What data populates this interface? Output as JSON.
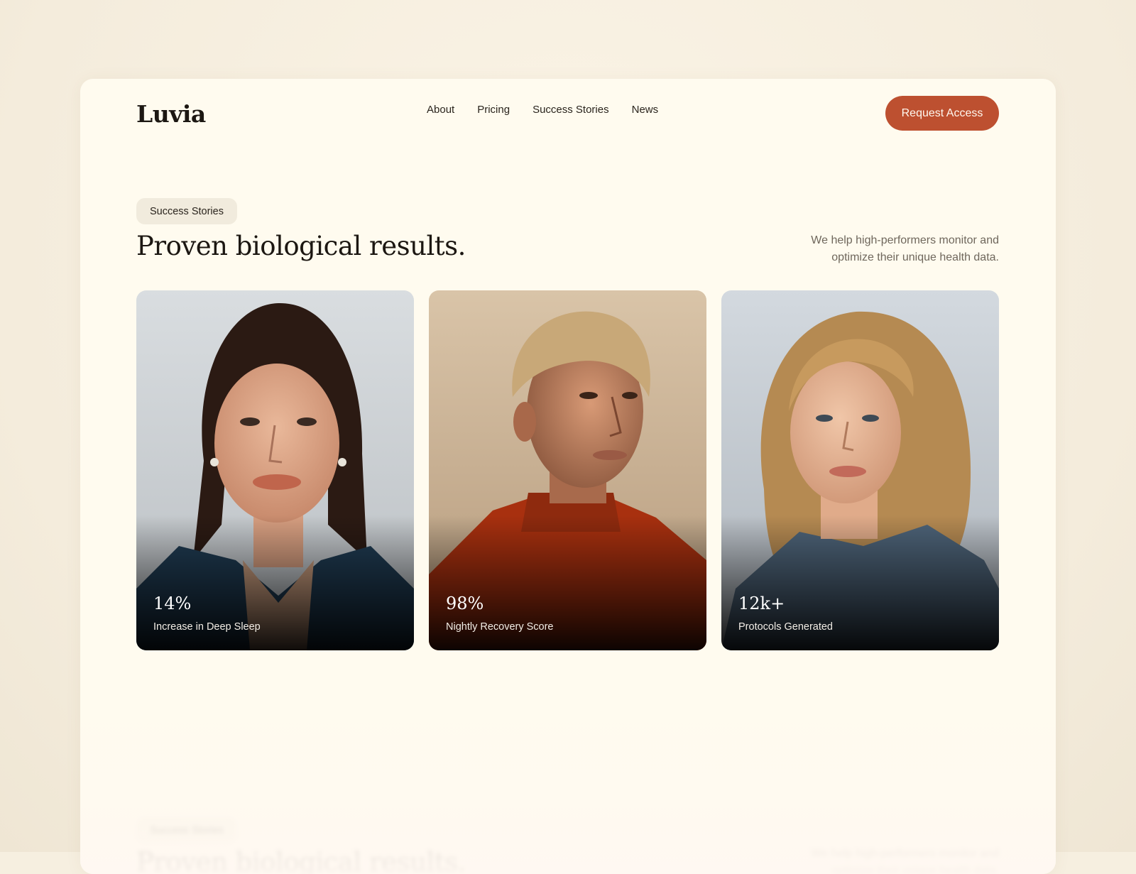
{
  "brand": {
    "name": "Luvia"
  },
  "nav": {
    "items": [
      {
        "label": "About"
      },
      {
        "label": "Pricing"
      },
      {
        "label": "Success Stories"
      },
      {
        "label": "News"
      }
    ],
    "cta_label": "Request Access"
  },
  "hero": {
    "badge": "Success Stories",
    "headline": "Proven biological results.",
    "tagline": "We help high-performers monitor and optimize their unique health data."
  },
  "stats": [
    {
      "value": "14%",
      "label": "Increase in Deep Sleep",
      "portrait_icon": "woman-dark-hair-portrait"
    },
    {
      "value": "98%",
      "label": "Nightly Recovery Score",
      "portrait_icon": "man-orange-sweater-portrait"
    },
    {
      "value": "12k+",
      "label": "Protocols Generated",
      "portrait_icon": "woman-curly-hair-portrait"
    }
  ],
  "colors": {
    "accent": "#bd5030",
    "page_bg": "#f6efe0",
    "card_bg": "#fffbef",
    "text": "#1c1712"
  }
}
